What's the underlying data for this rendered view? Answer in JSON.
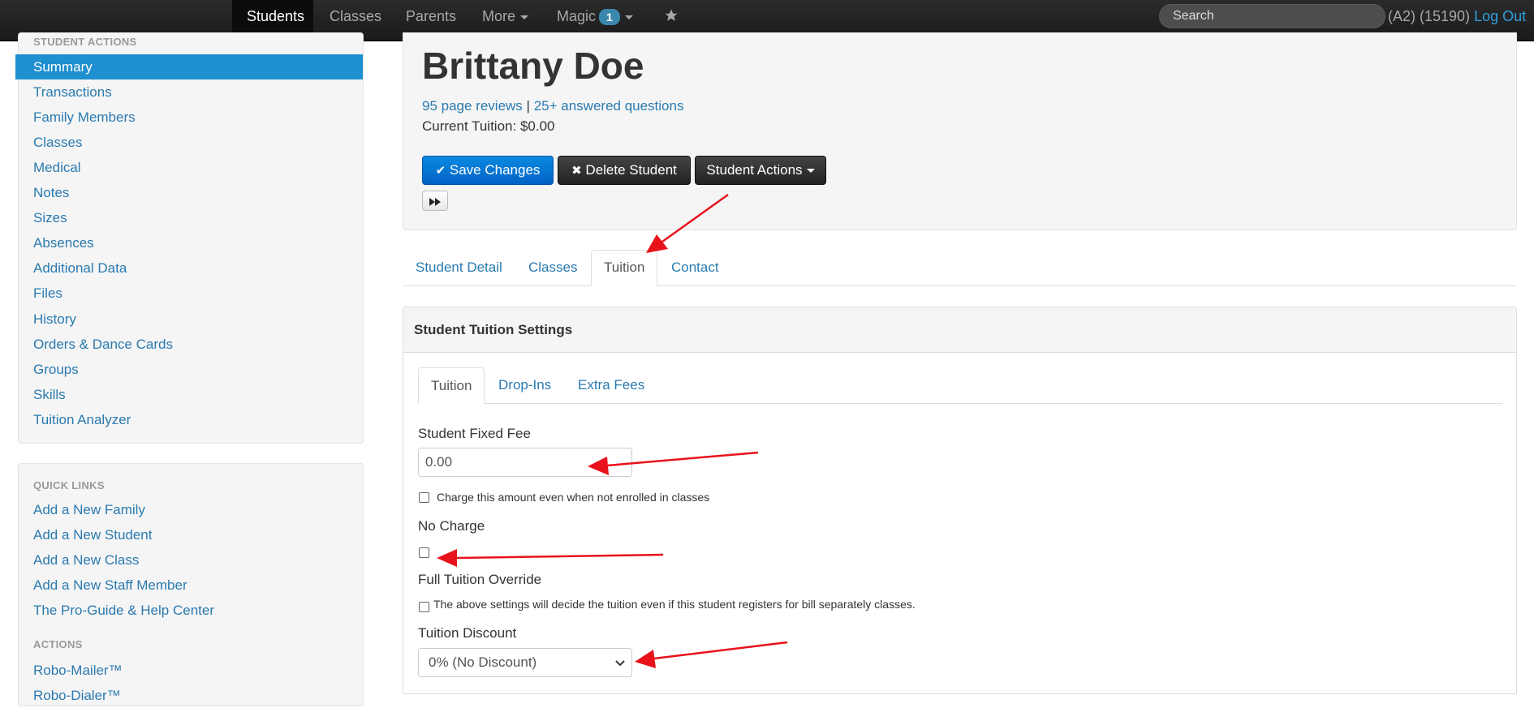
{
  "navbar": {
    "items": [
      {
        "label": "Students",
        "active": true
      },
      {
        "label": "Classes"
      },
      {
        "label": "Parents"
      },
      {
        "label": "More"
      },
      {
        "label": "Magic"
      }
    ],
    "magic_badge": "1",
    "search_placeholder": "Search",
    "account_text": "(A2) (15190)",
    "logout_label": "Log Out"
  },
  "sidebar": {
    "section_header": "STUDENT ACTIONS",
    "items": [
      "Summary",
      "Transactions",
      "Family Members",
      "Classes",
      "Medical",
      "Notes",
      "Sizes",
      "Absences",
      "Additional Data",
      "Files",
      "History",
      "Orders & Dance Cards",
      "Groups",
      "Skills",
      "Tuition Analyzer"
    ],
    "quick_links_header": "QUICK LINKS",
    "quick_links": [
      "Add a New Family",
      "Add a New Student",
      "Add a New Class",
      "Add a New Staff Member",
      "The Pro-Guide & Help Center"
    ],
    "actions_header": "ACTIONS",
    "actions": [
      "Robo-Mailer™",
      "Robo-Dialer™"
    ]
  },
  "student": {
    "name": "Brittany Doe",
    "reviews_link": "95 page reviews",
    "separator": "|",
    "questions_link": "25+ answered questions",
    "tuition_text": "Current Tuition: $0.00"
  },
  "buttons": {
    "save": "Save Changes",
    "delete": "Delete Student",
    "actions": "Student Actions"
  },
  "tabs": [
    "Student Detail",
    "Classes",
    "Tuition",
    "Contact"
  ],
  "tuition_panel": {
    "title": "Student Tuition Settings",
    "subtabs": [
      "Tuition",
      "Drop-Ins",
      "Extra Fees"
    ],
    "fixed_fee_label": "Student Fixed Fee",
    "fixed_fee_value": "0.00",
    "charge_checkbox_label": "Charge this amount even when not enrolled in classes",
    "no_charge_label": "No Charge",
    "override_label": "Full Tuition Override",
    "override_checkbox_label": "The above settings will decide the tuition even if this student registers for bill separately classes.",
    "discount_label": "Tuition Discount",
    "discount_value": "0% (No Discount)"
  },
  "colors": {
    "annotation_arrow": "#e8121b",
    "primary": "#0071d4",
    "active_sidebar": "#1e8fcf"
  }
}
